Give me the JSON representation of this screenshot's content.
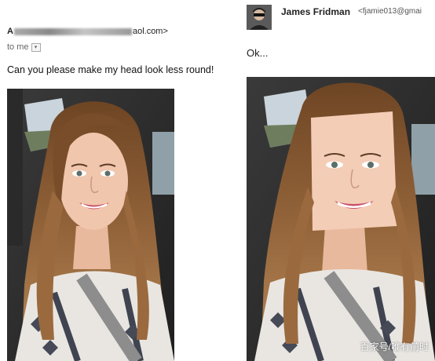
{
  "left_email": {
    "sender_initial": "A",
    "sender_domain": "aol.com>",
    "to_label": "to me",
    "to_chevron": "▾",
    "message": "Can you please make my head look less round!"
  },
  "right_email": {
    "sender_name": "James Fridman",
    "sender_email": "<fjamie013@gmai",
    "reply": "Ok..."
  },
  "watermark": "百家号/唯有前时",
  "icons": {
    "avatar": "avatar-photo",
    "chevron": "chevron-down-icon"
  },
  "colors": {
    "background": "#ffffff",
    "hair": "#8a5a34",
    "skin": "#f0c6ad",
    "lips": "#c8506a"
  }
}
